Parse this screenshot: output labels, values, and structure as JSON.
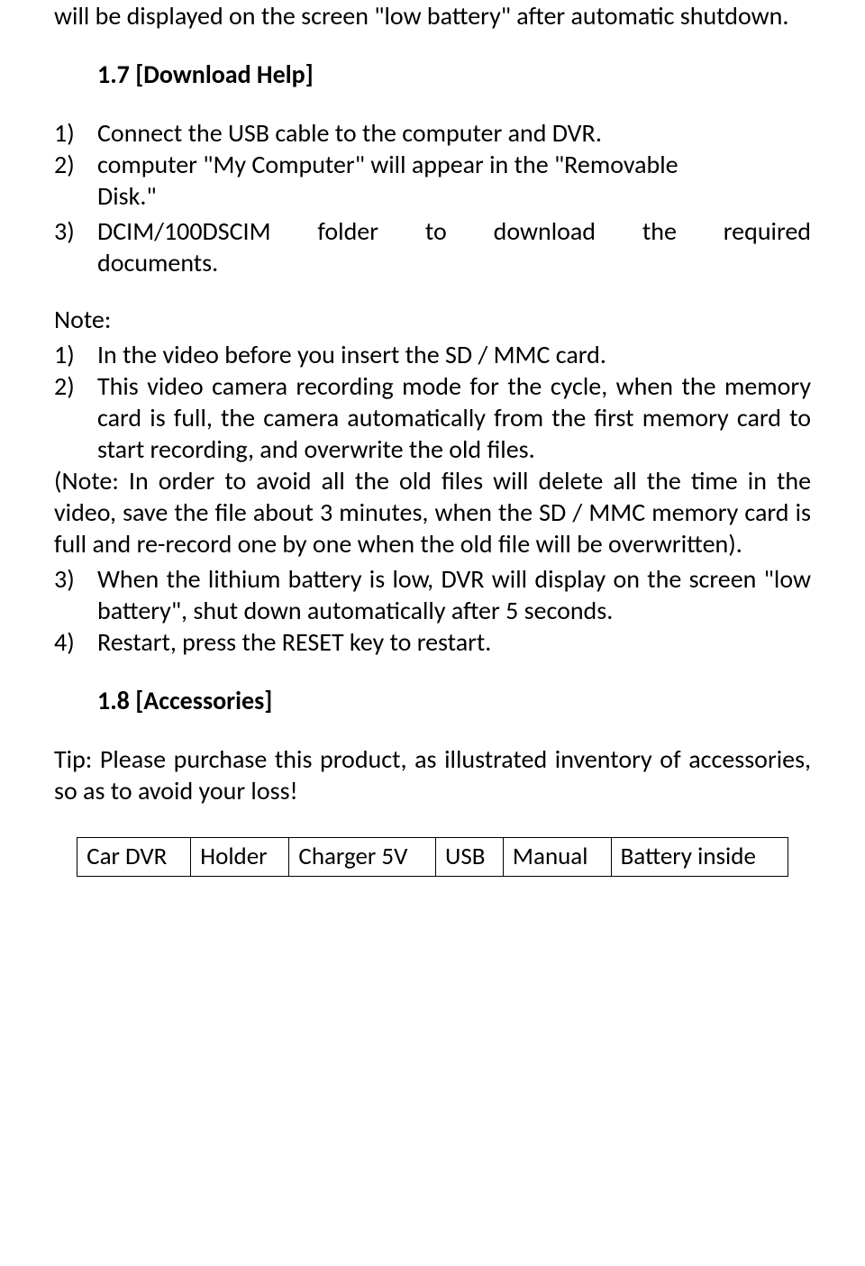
{
  "intro": "will be displayed on the screen \"low battery\" after automatic shutdown.",
  "section1": {
    "heading": "1.7 [Download Help]",
    "item1_num": "1)",
    "item1_txt": "Connect the USB cable to the computer and DVR.",
    "item2_num": "2)",
    "item2_txt_a": "computer \"My Computer\" will appear in the \"Removable",
    "item2_txt_b": "Disk.\"",
    "item3_num": "3)",
    "item3_txt_a": "DCIM/100DSCIM folder to download the required",
    "item3_txt_b": "documents."
  },
  "notes": {
    "label": "Note:",
    "n1_num": "1)",
    "n1_txt": "In the video before you insert the SD / MMC card.",
    "n2_num": "2)",
    "n2_txt": "This video camera recording mode for the cycle, when the memory card is full, the camera automatically from the first memory card to start recording, and overwrite the old files.",
    "note_paren": "(Note: In order to avoid all the old files will delete all the time in the video, save the file about 3 minutes, when the SD / MMC memory card is full and re-record one by one when the old file will be overwritten).",
    "n3_num": "3)",
    "n3_txt": "When the lithium battery is low, DVR will display on the screen \"low battery\", shut down automatically after 5 seconds.",
    "n4_num": "4)",
    "n4_txt": "Restart, press the RESET key to restart."
  },
  "section2": {
    "heading": "1.8 [Accessories]",
    "tip": "Tip: Please purchase this product, as illustrated inventory of accessories, so as to avoid your loss!"
  },
  "table": {
    "c0": "Car DVR",
    "c1": "Holder",
    "c2": "Charger 5V",
    "c3": "USB",
    "c4": "Manual",
    "c5": "Battery inside"
  }
}
